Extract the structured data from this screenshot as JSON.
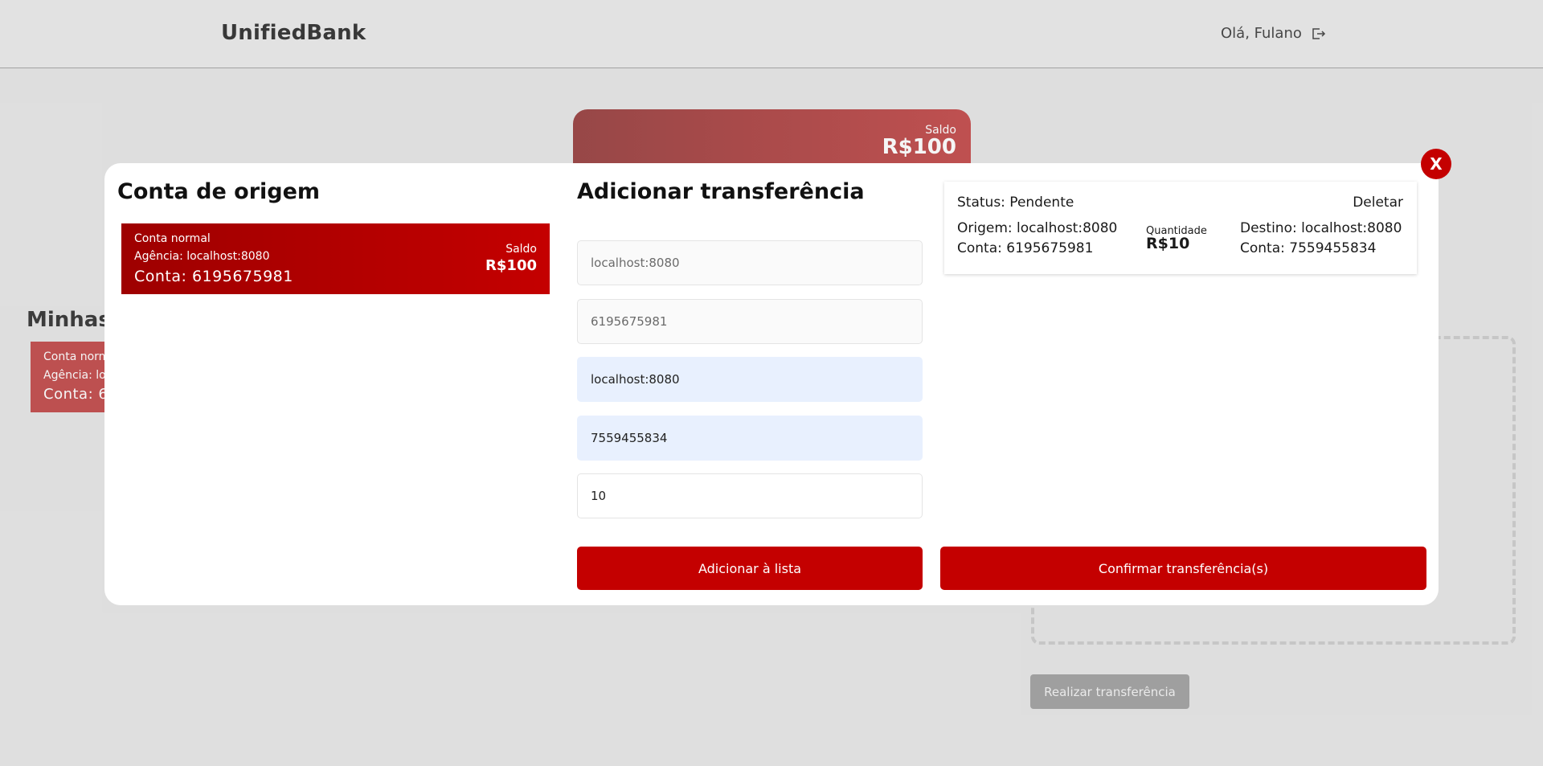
{
  "header": {
    "brand": "UnifiedBank",
    "greeting": "Olá, Fulano",
    "logout_icon": "logout-icon"
  },
  "background": {
    "balance_label": "Saldo",
    "balance_value": "R$100",
    "section_title": "Minhas",
    "account_card": {
      "type": "Conta norm",
      "agency": "Agência: lo",
      "account": "Conta: 6"
    },
    "submit_label": "Realizar transferência"
  },
  "modal": {
    "close_label": "X",
    "origin_title": "Conta de origem",
    "origin_card": {
      "type": "Conta normal",
      "agency": "Agência: localhost:8080",
      "account": "Conta: 6195675981",
      "balance_label": "Saldo",
      "balance_value": "R$100"
    },
    "add_title": "Adicionar transferência",
    "fields": {
      "origin_agency_placeholder": "localhost:8080",
      "origin_account_placeholder": "6195675981",
      "dest_agency_value": "localhost:8080",
      "dest_account_value": "7559455834",
      "amount_value": "10"
    },
    "add_button": "Adicionar à lista",
    "confirm_button": "Confirmar transferência(s)",
    "pending_transfer": {
      "status": "Status: Pendente",
      "delete": "Deletar",
      "origin": "Origem: localhost:8080",
      "origin_account": "Conta: 6195675981",
      "quantity_label": "Quantidade",
      "quantity_value": "R$10",
      "destination": "Destino: localhost:8080",
      "destination_account": "Conta: 7559455834"
    }
  },
  "colors": {
    "primary": "#c40000",
    "primary_dark": "#9e0000",
    "background": "#e8e8e8"
  }
}
